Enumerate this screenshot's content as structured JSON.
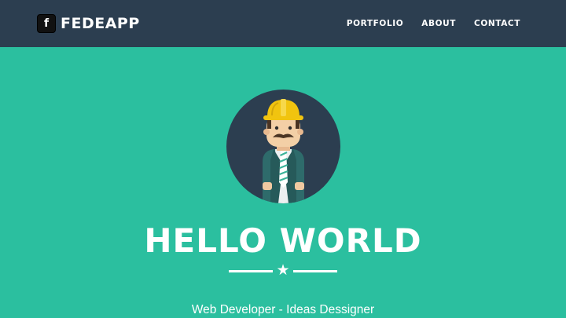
{
  "navbar": {
    "brand": {
      "logo_glyph": "f",
      "logo_icon": "facebook-icon",
      "name": "FEDEAPP"
    },
    "links": [
      {
        "label": "PORTFOLIO"
      },
      {
        "label": "ABOUT"
      },
      {
        "label": "CONTACT"
      }
    ]
  },
  "hero": {
    "avatar_icon": "builder-avatar-icon",
    "headline": "HELLO WORLD",
    "divider_icon": "star-icon",
    "divider_glyph": "★",
    "tagline": "Web Developer - Ideas Dessigner"
  },
  "colors": {
    "navbar_bg": "#2c3e50",
    "hero_bg": "#2bbf9f",
    "avatar_bg": "#2c3e50",
    "text": "#ffffff"
  }
}
